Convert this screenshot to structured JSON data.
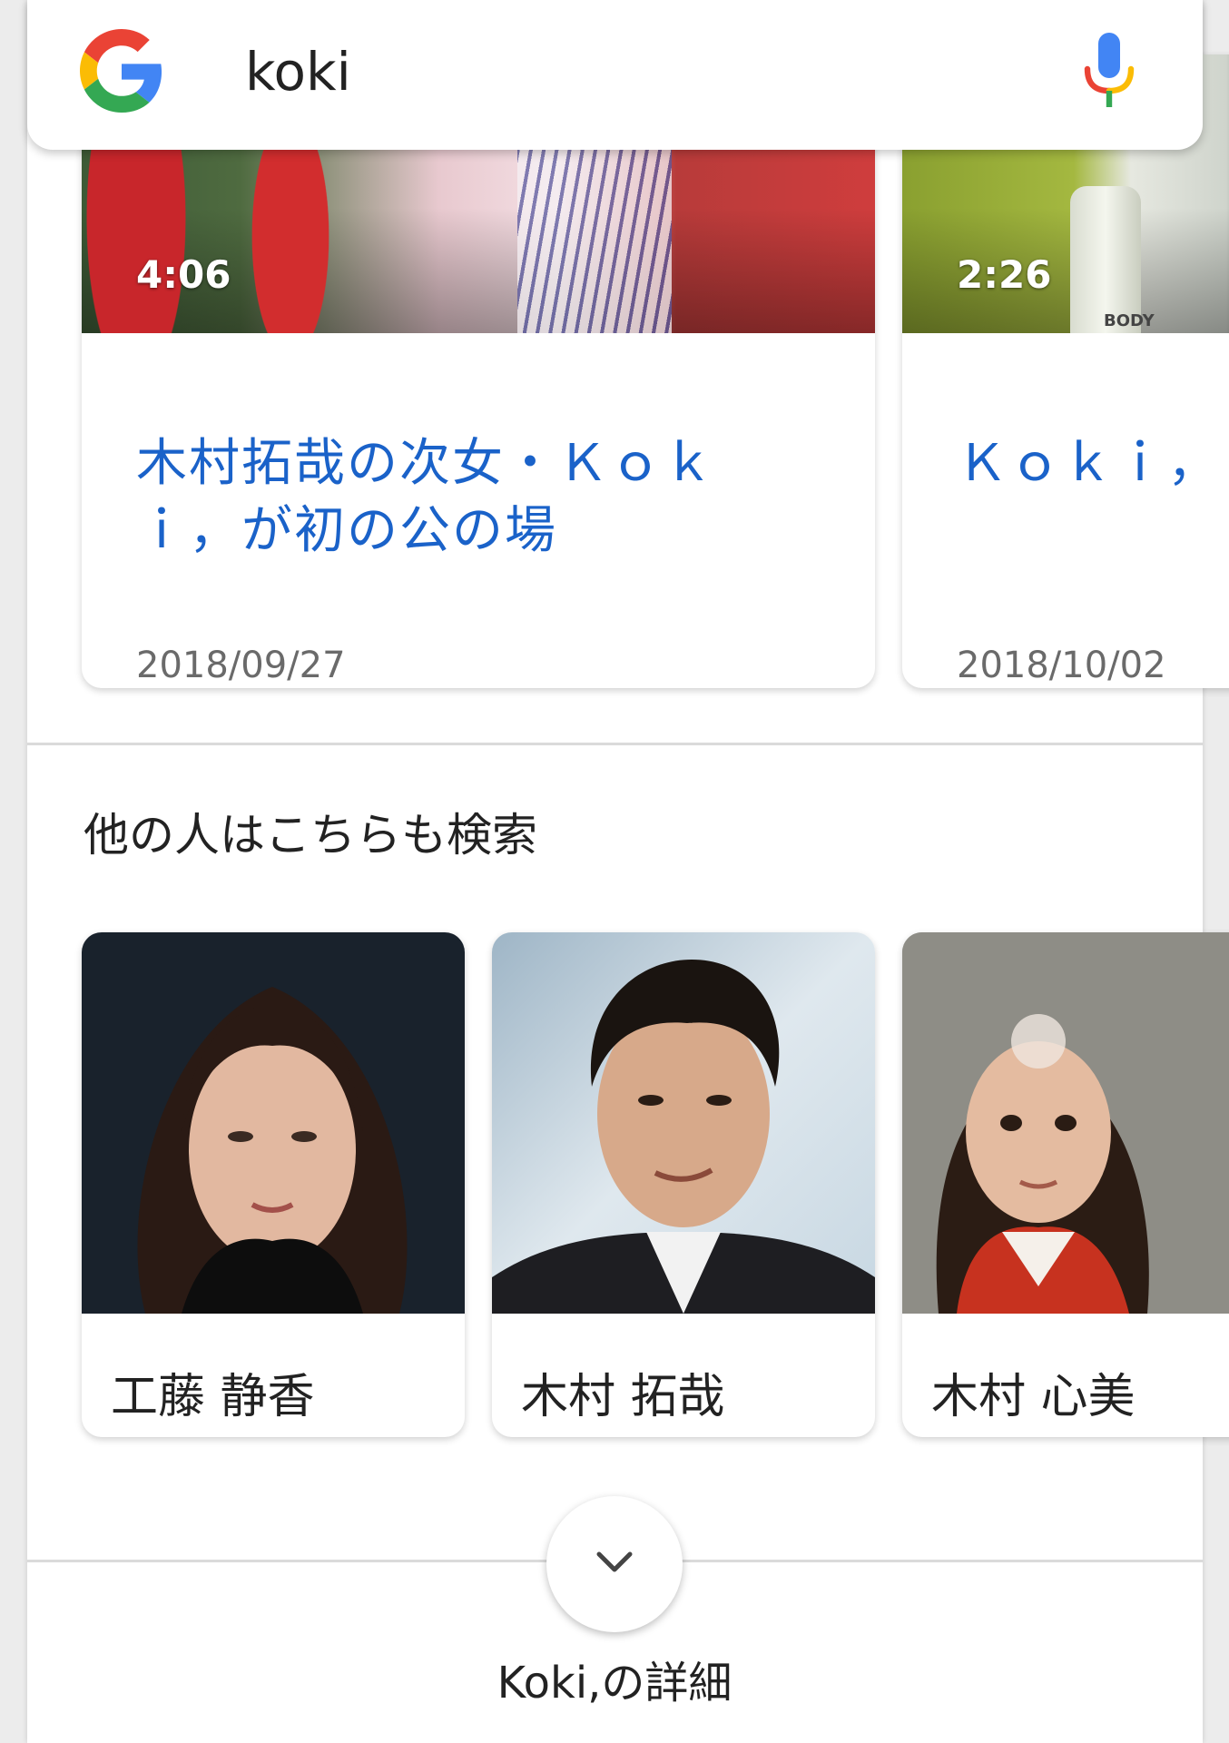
{
  "search": {
    "query": "koki"
  },
  "videos": [
    {
      "duration": "4:06",
      "title": "木村拓哉の次女・Ｋｏｋｉ，が初の公の場",
      "date": "2018/09/27"
    },
    {
      "duration": "2:26",
      "title": "Ｋｏｋｉ，",
      "date": "2018/10/02",
      "thumb_text": "BODY"
    }
  ],
  "related": {
    "heading": "他の人はこちらも検索",
    "people": [
      {
        "name": "工藤 静香"
      },
      {
        "name": "木村 拓哉"
      },
      {
        "name": "木村 心美"
      }
    ]
  },
  "footer": {
    "more_label": "Koki,の詳細"
  },
  "colors": {
    "link": "#1a62c9",
    "google_blue": "#4285F4",
    "google_red": "#EA4335",
    "google_yellow": "#FBBC05",
    "google_green": "#34A853"
  }
}
